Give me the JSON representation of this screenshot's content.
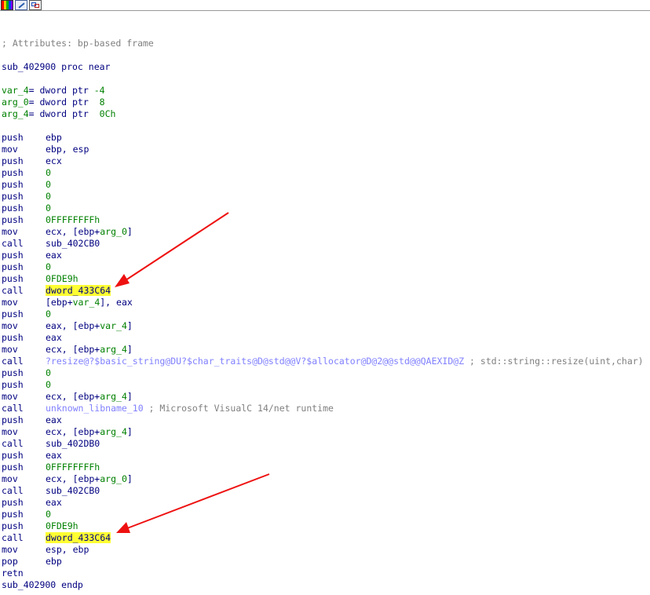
{
  "toolbar": {
    "buttons": [
      {
        "name": "graph-view-icon"
      },
      {
        "name": "edit-icon"
      },
      {
        "name": "flowchart-icon"
      }
    ]
  },
  "header": {
    "attributes_comment": "; Attributes: bp-based frame",
    "proc_start": "sub_402900 proc near",
    "locals": [
      {
        "name": "var_4",
        "decl": "= dword ptr ",
        "value": "-4"
      },
      {
        "name": "arg_0",
        "decl": "= dword ptr  ",
        "value": "8"
      },
      {
        "name": "arg_4",
        "decl": "= dword ptr  ",
        "value": "0Ch"
      }
    ]
  },
  "instructions": {
    "i0": {
      "mn": "push",
      "a": "ebp"
    },
    "i1": {
      "mn": "mov",
      "a": "ebp, esp"
    },
    "i2": {
      "mn": "push",
      "a": "ecx"
    },
    "i3": {
      "mn": "push",
      "n": "0"
    },
    "i4": {
      "mn": "push",
      "n": "0"
    },
    "i5": {
      "mn": "push",
      "n": "0"
    },
    "i6": {
      "mn": "push",
      "n": "0"
    },
    "i7": {
      "mn": "push",
      "n": "0FFFFFFFFh"
    },
    "i8": {
      "mn": "mov",
      "a": "ecx, [ebp+",
      "v": "arg_0",
      "b": "]"
    },
    "i9": {
      "mn": "call",
      "a": "sub_402CB0"
    },
    "i10": {
      "mn": "push",
      "a": "eax"
    },
    "i11": {
      "mn": "push",
      "n": "0"
    },
    "i12": {
      "mn": "push",
      "n": "0FDE9h"
    },
    "i13": {
      "mn": "call",
      "h": "dword_433C64"
    },
    "i14": {
      "mn": "mov",
      "a": "[ebp+",
      "v": "var_4",
      "b": "], eax"
    },
    "i15": {
      "mn": "push",
      "n": "0"
    },
    "i16": {
      "mn": "mov",
      "a": "eax, [ebp+",
      "v": "var_4",
      "b": "]"
    },
    "i17": {
      "mn": "push",
      "a": "eax"
    },
    "i18": {
      "mn": "mov",
      "a": "ecx, [ebp+",
      "v": "arg_4",
      "b": "]"
    },
    "i19": {
      "mn": "call",
      "l": "?resize@?$basic_string@DU?$char_traits@D@std@@V?$allocator@D@2@@std@@QAEXID@Z",
      "c": " ; std::string::resize(uint,char)"
    },
    "i20": {
      "mn": "push",
      "n": "0"
    },
    "i21": {
      "mn": "push",
      "n": "0"
    },
    "i22": {
      "mn": "mov",
      "a": "ecx, [ebp+",
      "v": "arg_4",
      "b": "]"
    },
    "i23": {
      "mn": "call",
      "l": "unknown_libname_10",
      "c": " ; Microsoft VisualC 14/net runtime"
    },
    "i24": {
      "mn": "push",
      "a": "eax"
    },
    "i25": {
      "mn": "mov",
      "a": "ecx, [ebp+",
      "v": "arg_4",
      "b": "]"
    },
    "i26": {
      "mn": "call",
      "a": "sub_402DB0"
    },
    "i27": {
      "mn": "push",
      "a": "eax"
    },
    "i28": {
      "mn": "push",
      "n": "0FFFFFFFFh"
    },
    "i29": {
      "mn": "mov",
      "a": "ecx, [ebp+",
      "v": "arg_0",
      "b": "]"
    },
    "i30": {
      "mn": "call",
      "a": "sub_402CB0"
    },
    "i31": {
      "mn": "push",
      "a": "eax"
    },
    "i32": {
      "mn": "push",
      "n": "0"
    },
    "i33": {
      "mn": "push",
      "n": "0FDE9h"
    },
    "i34": {
      "mn": "call",
      "h": "dword_433C64"
    },
    "i35": {
      "mn": "mov",
      "a": "esp, ebp"
    },
    "i36": {
      "mn": "pop",
      "a": "ebp"
    },
    "i37": {
      "mn": "retn"
    }
  },
  "footer": {
    "proc_end": "sub_402900 endp"
  },
  "colors": {
    "instruction_text": "#000080",
    "numeric_constant": "#008000",
    "library_function": "#8080ff",
    "comment": "#808080",
    "highlight": "#ffff33",
    "annotation_arrow": "#ee1111"
  }
}
